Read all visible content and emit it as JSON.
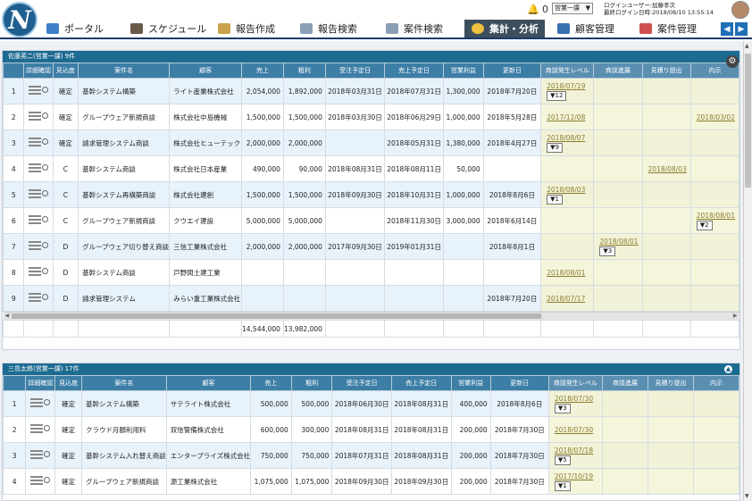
{
  "header": {
    "notification_count": "0",
    "group_select": "営業一課",
    "login_user": "ログインユーザー:加藤孝次",
    "last_login": "最終ログイン日時:2018/08/10 13:55:14"
  },
  "nav": [
    {
      "label": "ポータル"
    },
    {
      "label": "スケジュール"
    },
    {
      "label": "報告作成"
    },
    {
      "label": "報告検索"
    },
    {
      "label": "案件検索"
    },
    {
      "label": "集計・分析"
    },
    {
      "label": "顧客管理"
    },
    {
      "label": "案件管理"
    }
  ],
  "columns": [
    "詳細確認",
    "見込度",
    "案件名",
    "顧客",
    "売上",
    "粗利",
    "受注予定日",
    "売上予定日",
    "営業利益",
    "更新日",
    "商談発生レベル",
    "商談進展",
    "見積り提出",
    "内示"
  ],
  "panel1": {
    "title": "佐藤英二(営業一課) 9件",
    "rows": [
      {
        "no": "1",
        "mk": "確定",
        "name": "基幹システム構築",
        "client": "ライト産業株式会社",
        "sales": "2,054,000",
        "gross": "1,892,000",
        "order": "2018年03月31日",
        "sdate": "2018年07月31日",
        "profit": "1,300,000",
        "upd": "2018年7月20日",
        "lvl": "2018/07/19",
        "lvlb": "▼12",
        "prog": "",
        "progb": "",
        "est": "",
        "nai": "",
        "naib": ""
      },
      {
        "no": "2",
        "mk": "確定",
        "name": "グループウェア新規商談",
        "client": "株式会社中島機械",
        "sales": "1,500,000",
        "gross": "1,500,000",
        "order": "2018年03月30日",
        "sdate": "2018年06月29日",
        "profit": "1,000,000",
        "upd": "2018年5月28日",
        "lvl": "2017/12/08",
        "lvlb": "",
        "prog": "",
        "progb": "",
        "est": "",
        "nai": "2018/03/02",
        "naib": ""
      },
      {
        "no": "3",
        "mk": "確定",
        "name": "請求管理システム商談",
        "client": "株式会社ヒューテック",
        "sales": "2,000,000",
        "gross": "2,000,000",
        "order": "",
        "sdate": "2018年05月31日",
        "profit": "1,380,000",
        "upd": "2018年4月27日",
        "lvl": "2018/08/07",
        "lvlb": "▼9",
        "prog": "",
        "progb": "",
        "est": "",
        "nai": "",
        "naib": ""
      },
      {
        "no": "4",
        "mk": "C",
        "name": "基幹システム商談",
        "client": "株式会社日本産業",
        "sales": "490,000",
        "gross": "90,000",
        "order": "2018年08月31日",
        "sdate": "2018年08月11日",
        "profit": "50,000",
        "upd": "",
        "lvl": "",
        "lvlb": "",
        "prog": "",
        "progb": "",
        "est": "2018/08/03",
        "nai": "",
        "naib": ""
      },
      {
        "no": "5",
        "mk": "C",
        "name": "基幹システム再構築商談",
        "client": "株式会社建創",
        "sales": "1,500,000",
        "gross": "1,500,000",
        "order": "2018年09月30日",
        "sdate": "2018年10月31日",
        "profit": "1,000,000",
        "upd": "2018年8月6日",
        "lvl": "2018/08/03",
        "lvlb": "▼1",
        "prog": "",
        "progb": "",
        "est": "",
        "nai": "",
        "naib": ""
      },
      {
        "no": "6",
        "mk": "C",
        "name": "グループウェア新規商談",
        "client": "クウエイ建設",
        "sales": "5,000,000",
        "gross": "5,000,000",
        "order": "",
        "sdate": "2018年11月30日",
        "profit": "3,000,000",
        "upd": "2018年6月14日",
        "lvl": "",
        "lvlb": "",
        "prog": "",
        "progb": "",
        "est": "",
        "nai": "2018/08/01",
        "naib": "▼2"
      },
      {
        "no": "7",
        "mk": "D",
        "name": "グループウェア切り替え商談",
        "client": "三信工業株式会社",
        "sales": "2,000,000",
        "gross": "2,000,000",
        "order": "2017年09月30日",
        "sdate": "2019年01月31日",
        "profit": "",
        "upd": "2018年8月1日",
        "lvl": "",
        "lvlb": "",
        "prog": "2018/08/01",
        "progb": "▼3",
        "est": "",
        "nai": "",
        "naib": ""
      },
      {
        "no": "8",
        "mk": "D",
        "name": "基幹システム商談",
        "client": "戸野間土建工業",
        "sales": "",
        "gross": "",
        "order": "",
        "sdate": "",
        "profit": "",
        "upd": "",
        "lvl": "2018/08/01",
        "lvlb": "",
        "prog": "",
        "progb": "",
        "est": "",
        "nai": "",
        "naib": ""
      },
      {
        "no": "9",
        "mk": "D",
        "name": "請求管理システム",
        "client": "みらい重工業株式会社",
        "sales": "",
        "gross": "",
        "order": "",
        "sdate": "",
        "profit": "",
        "upd": "2018年7月20日",
        "lvl": "2018/07/17",
        "lvlb": "",
        "prog": "",
        "progb": "",
        "est": "",
        "nai": "",
        "naib": ""
      }
    ],
    "total_sales": "14,544,000",
    "total_gross": "13,982,000"
  },
  "panel2": {
    "title": "三島太郎(営業一課) 17件",
    "rows": [
      {
        "no": "1",
        "mk": "確定",
        "name": "基幹システム構築",
        "client": "サテライト株式会社",
        "sales": "500,000",
        "gross": "500,000",
        "order": "2018年06月30日",
        "sdate": "2018年08月31日",
        "profit": "400,000",
        "upd": "2018年8月6日",
        "lvl": "2018/07/30",
        "lvlb": "▼3"
      },
      {
        "no": "2",
        "mk": "確定",
        "name": "クラウド月額利用料",
        "client": "双信警備株式会社",
        "sales": "600,000",
        "gross": "300,000",
        "order": "2018年08月31日",
        "sdate": "2018年08月31日",
        "profit": "200,000",
        "upd": "2018年7月30日",
        "lvl": "2018/07/30",
        "lvlb": ""
      },
      {
        "no": "3",
        "mk": "確定",
        "name": "基幹システム入れ替え商談",
        "client": "エンタープライズ株式会社",
        "sales": "750,000",
        "gross": "750,000",
        "order": "2018年07月31日",
        "sdate": "2018年08月31日",
        "profit": "200,000",
        "upd": "2018年7月30日",
        "lvl": "2018/07/18",
        "lvlb": "▼5"
      },
      {
        "no": "4",
        "mk": "確定",
        "name": "グループウェア新規商談",
        "client": "源工業株式会社",
        "sales": "1,075,000",
        "gross": "1,075,000",
        "order": "2018年09月30日",
        "sdate": "2018年09月30日",
        "profit": "200,000",
        "upd": "2018年7月30日",
        "lvl": "2017/10/19",
        "lvlb": "▼1"
      }
    ]
  }
}
